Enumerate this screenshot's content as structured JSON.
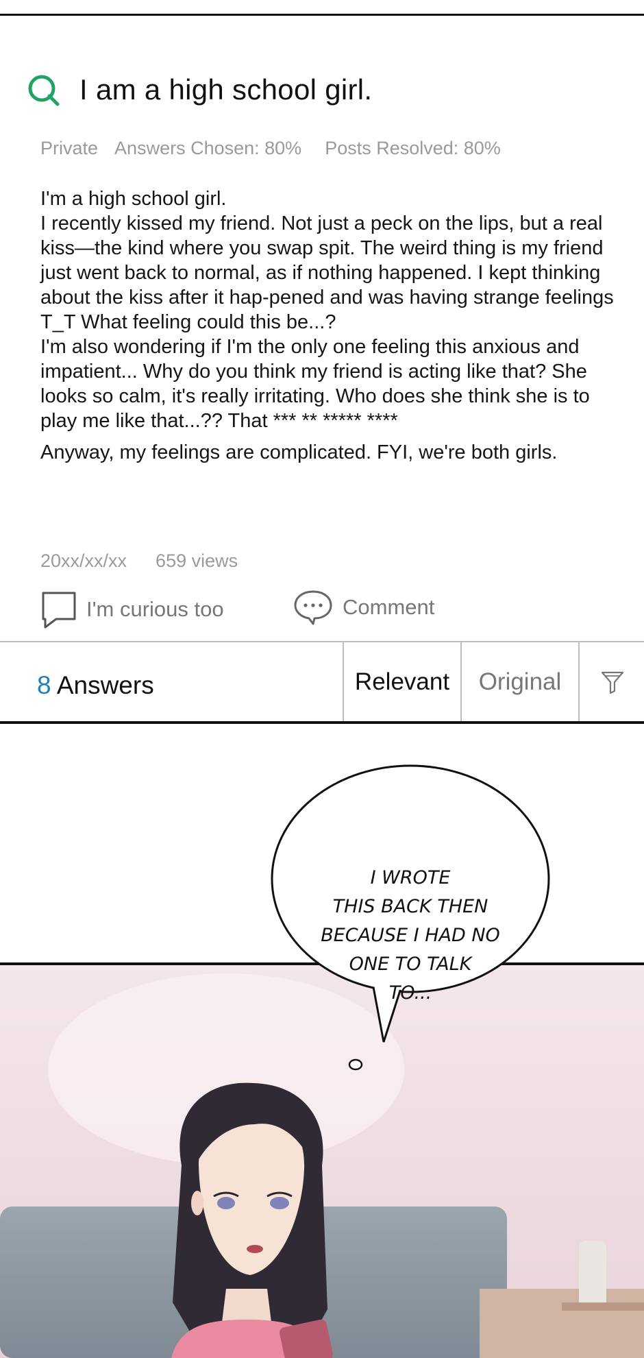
{
  "question": {
    "icon": "q-icon",
    "title": "I am a high school girl.",
    "meta": {
      "privacy": "Private",
      "answers_chosen": "Answers Chosen: 80%",
      "posts_resolved": "Posts Resolved: 80%"
    },
    "body": [
      "I'm a high school girl.",
      "I recently kissed my friend. Not just a peck on the lips, but a real kiss—the kind where you swap spit. The weird thing is my friend just went back to normal, as if nothing happened. I kept thinking about the kiss after it hap-pened and was having strange feelings T_T What feeling could this be...?",
      "I'm also wondering if I'm the only one feeling this anxious and impatient... Why do you think my friend is acting like that? She looks so calm, it's really irritating. Who does she think she is to play me like that...?? That *** ** ***** ****",
      "Anyway, my feelings are complicated. FYI, we're both girls."
    ],
    "date": "20xx/xx/xx",
    "views": "659 views"
  },
  "actions": {
    "curious_label": "I'm curious too",
    "comment_label": "Comment"
  },
  "answers": {
    "count": "8",
    "label": "Answers",
    "sort_relevant": "Relevant",
    "sort_original": "Original"
  },
  "comic": {
    "speech_bubble": [
      "I WROTE",
      "THIS BACK THEN",
      "BECAUSE I HAD NO",
      "ONE TO TALK",
      "TO..."
    ]
  },
  "colors": {
    "accent_green": "#1fa463",
    "count_blue": "#1f7fbf",
    "muted_text": "#9a9a9a"
  }
}
